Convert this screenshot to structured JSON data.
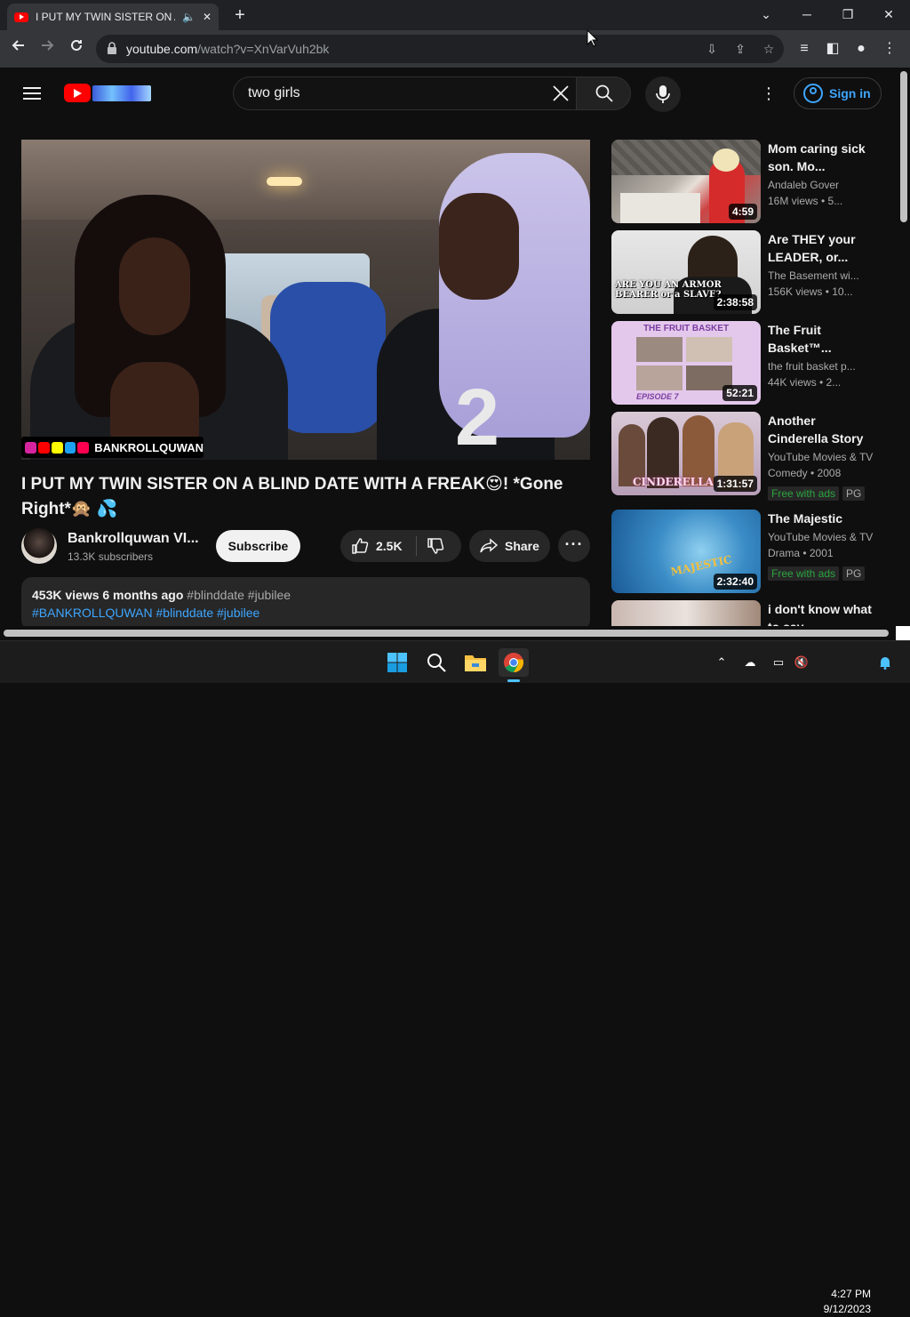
{
  "browser": {
    "tab_title": "I PUT MY TWIN SISTER ON A BLIND DATE WITH A FREAK",
    "url_host": "youtube.com",
    "url_path": "/watch?v=XnVarVuh2bk"
  },
  "header": {
    "search_query": "two girls",
    "signin_label": "Sign in"
  },
  "video": {
    "title": "I PUT MY TWIN SISTER ON A BLIND DATE WITH A FREAK😍! *Gone Right*🙊 💦",
    "watermark": "BANKROLLQUWAN",
    "channel_name": "Bankrollquwan VI...",
    "subscribers": "13.3K subscribers",
    "subscribe_label": "Subscribe",
    "likes": "2.5K",
    "share_label": "Share",
    "views_date": "453K views  6 months ago",
    "desc_tags": "#blinddate #jubilee",
    "desc_links": "#BANKROLLQUWAN #blinddate #jubilee"
  },
  "recommendations": [
    {
      "title": "Mom caring sick son. Mo...",
      "channel": "Andaleb Gover",
      "meta": "16M views • 5...",
      "duration": "4:59"
    },
    {
      "title": "Are THEY your LEADER, or...",
      "channel": "The Basement wi...",
      "meta": "156K views • 10...",
      "duration": "2:38:58",
      "thumb_text": "ARE YOU AN ARMOR BEARER or a SLAVE?"
    },
    {
      "title": "The Fruit Basket™...",
      "channel": "the fruit basket p...",
      "meta": "44K views • 2...",
      "duration": "52:21",
      "thumb_text": "THE FRUIT BASKET",
      "thumb_sub": "EPISODE 7"
    },
    {
      "title": "Another Cinderella Story",
      "channel": "YouTube Movies & TV",
      "meta": "Comedy • 2008",
      "duration": "1:31:57",
      "badge_free": "Free with ads",
      "badge_rating": "PG",
      "thumb_text": "CINDERELLA S"
    },
    {
      "title": "The Majestic",
      "channel": "YouTube Movies & TV",
      "meta": "Drama • 2001",
      "duration": "2:32:40",
      "badge_free": "Free with ads",
      "badge_rating": "PG",
      "thumb_text": "MAJESTIC"
    },
    {
      "title": "i don't know what to say",
      "channel": "",
      "meta": "",
      "duration": ""
    }
  ],
  "taskbar": {
    "time": "4:27 PM",
    "date": "9/12/2023"
  },
  "colors": {
    "accent_blue": "#3ea6ff",
    "youtube_red": "#ff0000",
    "free_green": "#2ba640"
  }
}
